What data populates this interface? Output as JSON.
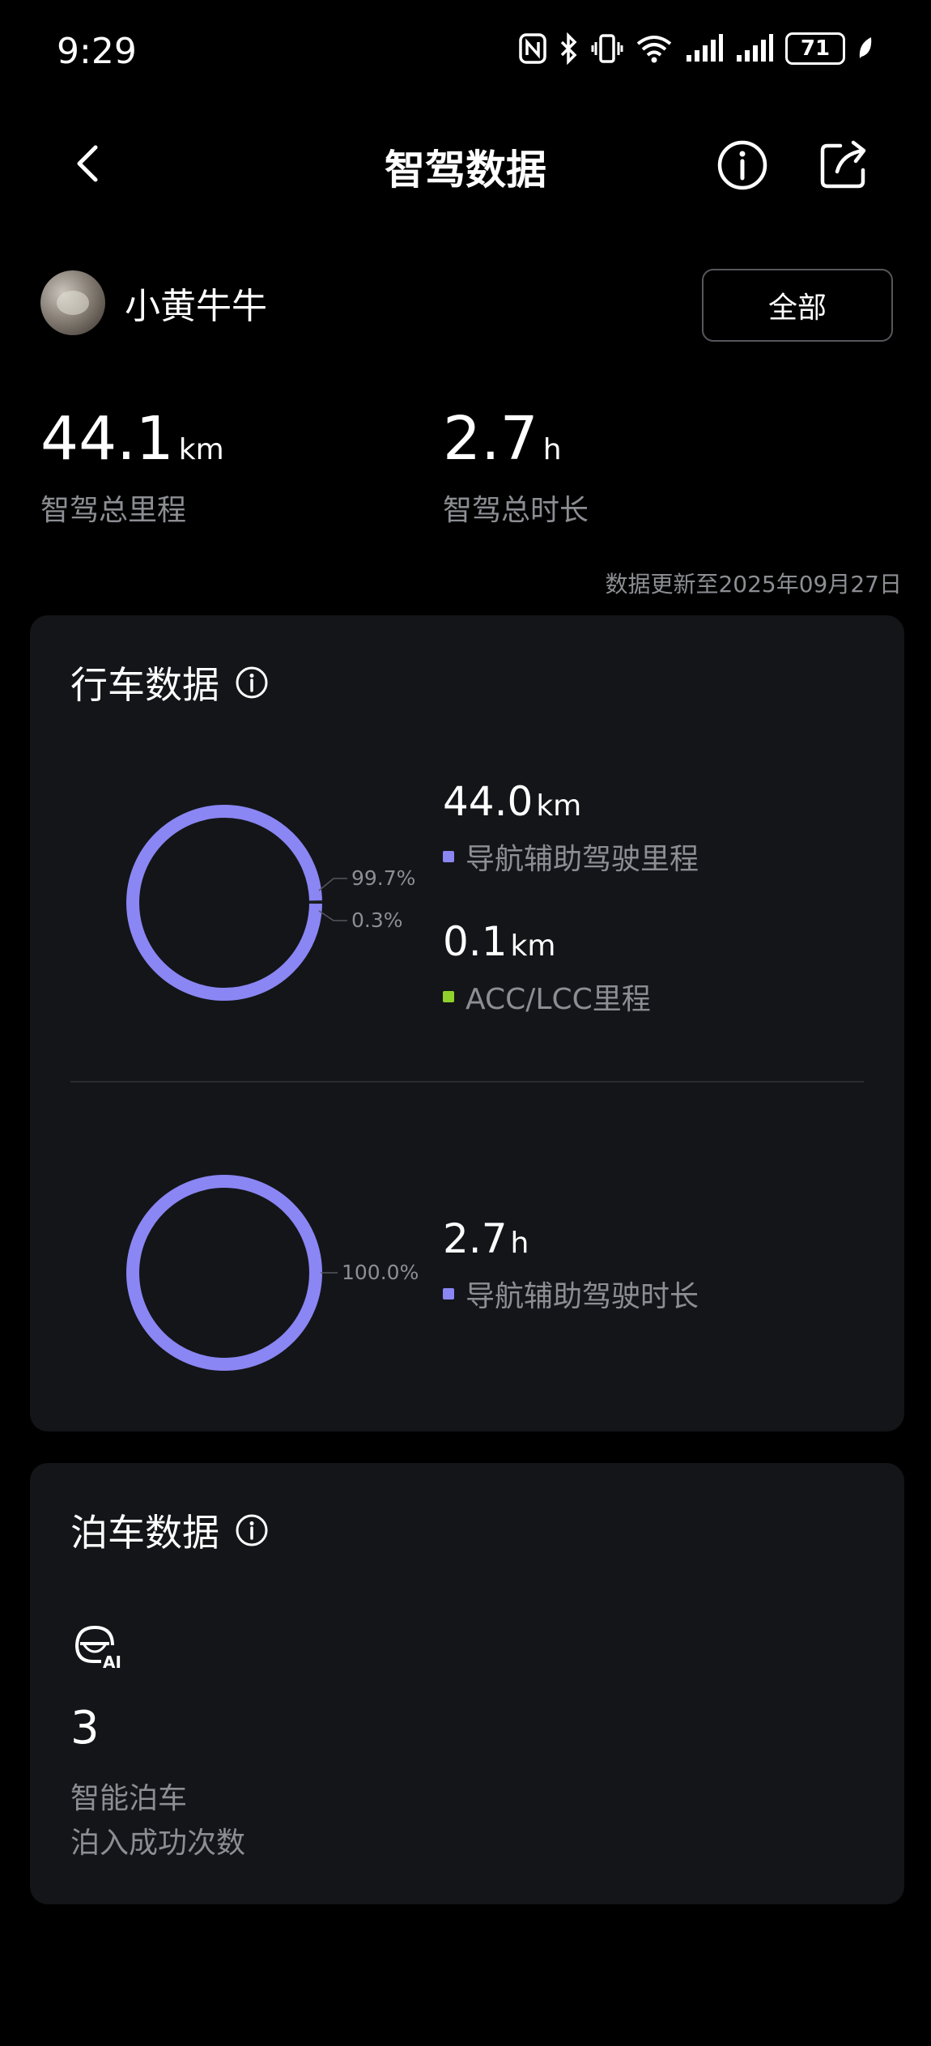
{
  "status_bar": {
    "time": "9:29",
    "battery": "71"
  },
  "header": {
    "title": "智驾数据",
    "icons": [
      "back-icon",
      "info-icon",
      "share-icon"
    ]
  },
  "user": {
    "name": "小黄牛牛",
    "filter_label": "全部"
  },
  "summary": {
    "total_distance": {
      "value": "44.1",
      "unit": "km",
      "label": "智驾总里程"
    },
    "total_duration": {
      "value": "2.7",
      "unit": "h",
      "label": "智驾总时长"
    }
  },
  "update_note": "数据更新至2025年09月27日",
  "driving_card": {
    "title": "行车数据",
    "distance_chart": {
      "segments": [
        {
          "percent_label": "99.7%",
          "fraction": 0.997,
          "color": "#8a86f4",
          "value": "44.0",
          "unit": "km",
          "label": "导航辅助驾驶里程"
        },
        {
          "percent_label": "0.3%",
          "fraction": 0.003,
          "color": "#8fd12c",
          "value": "0.1",
          "unit": "km",
          "label": "ACC/LCC里程"
        }
      ]
    },
    "duration_chart": {
      "segments": [
        {
          "percent_label": "100.0%",
          "fraction": 1.0,
          "color": "#8a86f4",
          "value": "2.7",
          "unit": "h",
          "label": "导航辅助驾驶时长"
        }
      ]
    }
  },
  "parking_card": {
    "title": "泊车数据",
    "icon": "ai-parking-icon",
    "count": "3",
    "label_line1": "智能泊车",
    "label_line2": "泊入成功次数"
  },
  "colors": {
    "background": "#000000",
    "card": "#141519",
    "primary_series": "#8a86f4",
    "secondary_series": "#8fd12c",
    "muted_text": "#8c8e93"
  }
}
